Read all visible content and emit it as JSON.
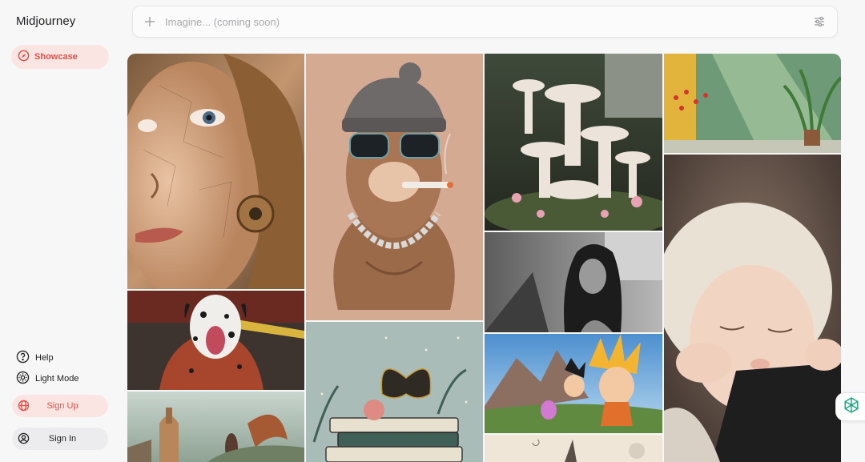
{
  "brand": "Midjourney",
  "nav": {
    "showcase_label": "Showcase"
  },
  "search": {
    "placeholder": "Imagine... (coming soon)"
  },
  "footer_links": {
    "help": "Help",
    "light_mode": "Light Mode"
  },
  "auth": {
    "signup": "Sign Up",
    "signin": "Sign In"
  },
  "colors": {
    "accent": "#e8514a",
    "accent_bg": "#fbe5e3",
    "page_bg": "#f7f7f8"
  },
  "gallery": {
    "images": [
      "cyborg-woman-face",
      "camel-with-sunglasses-and-cigar",
      "white-mushrooms-forest",
      "sunlit-green-room-with-plants",
      "sleeping-newborn-baby",
      "dalmatian-dog-firefighter",
      "woman-portrait-black-and-white-street",
      "anime-characters-on-cliff",
      "woman-with-bird-wings-city",
      "butterfly-on-stacked-books-with-moon",
      "partial-illustration-bottom"
    ]
  }
}
